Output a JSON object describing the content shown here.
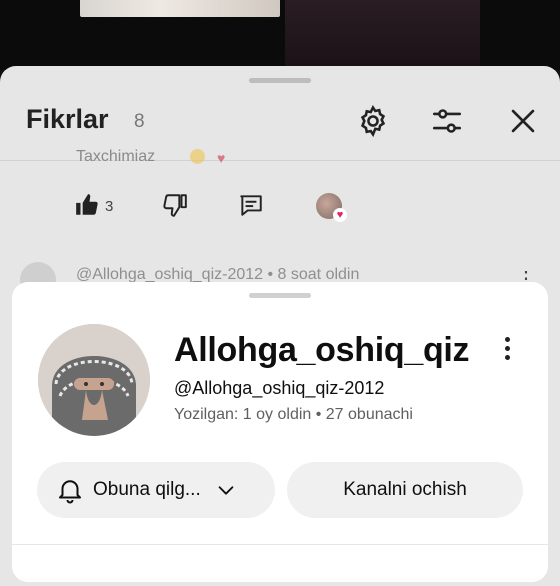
{
  "header": {
    "title": "Fikrlar",
    "count": "8"
  },
  "comment_above": {
    "partial_text": "Taxchimiaz",
    "like_count": "3"
  },
  "next_comment": {
    "meta": "@Allohga_oshiq_qiz-2012 • 8 soat oldin"
  },
  "profile_card": {
    "name": "Allohga_oshiq_qiz",
    "handle": "@Allohga_oshiq_qiz-2012",
    "meta": "Yozilgan: 1 oy oldin • 27 obunachi",
    "subscribe_label": "Obuna qilg...",
    "open_channel_label": "Kanalni ochish"
  },
  "icons": {
    "settings": "gear-icon",
    "filter": "sliders-icon",
    "close": "close-icon",
    "like": "thumb-up-icon",
    "dislike": "thumb-down-icon",
    "reply": "reply-icon",
    "bell": "bell-icon",
    "chevron": "chevron-down-icon"
  },
  "colors": {
    "sheet_bg": "#e6e6e6",
    "card_bg": "#ffffff",
    "button_bg": "#f0f0f0",
    "heart": "#e0245e"
  }
}
